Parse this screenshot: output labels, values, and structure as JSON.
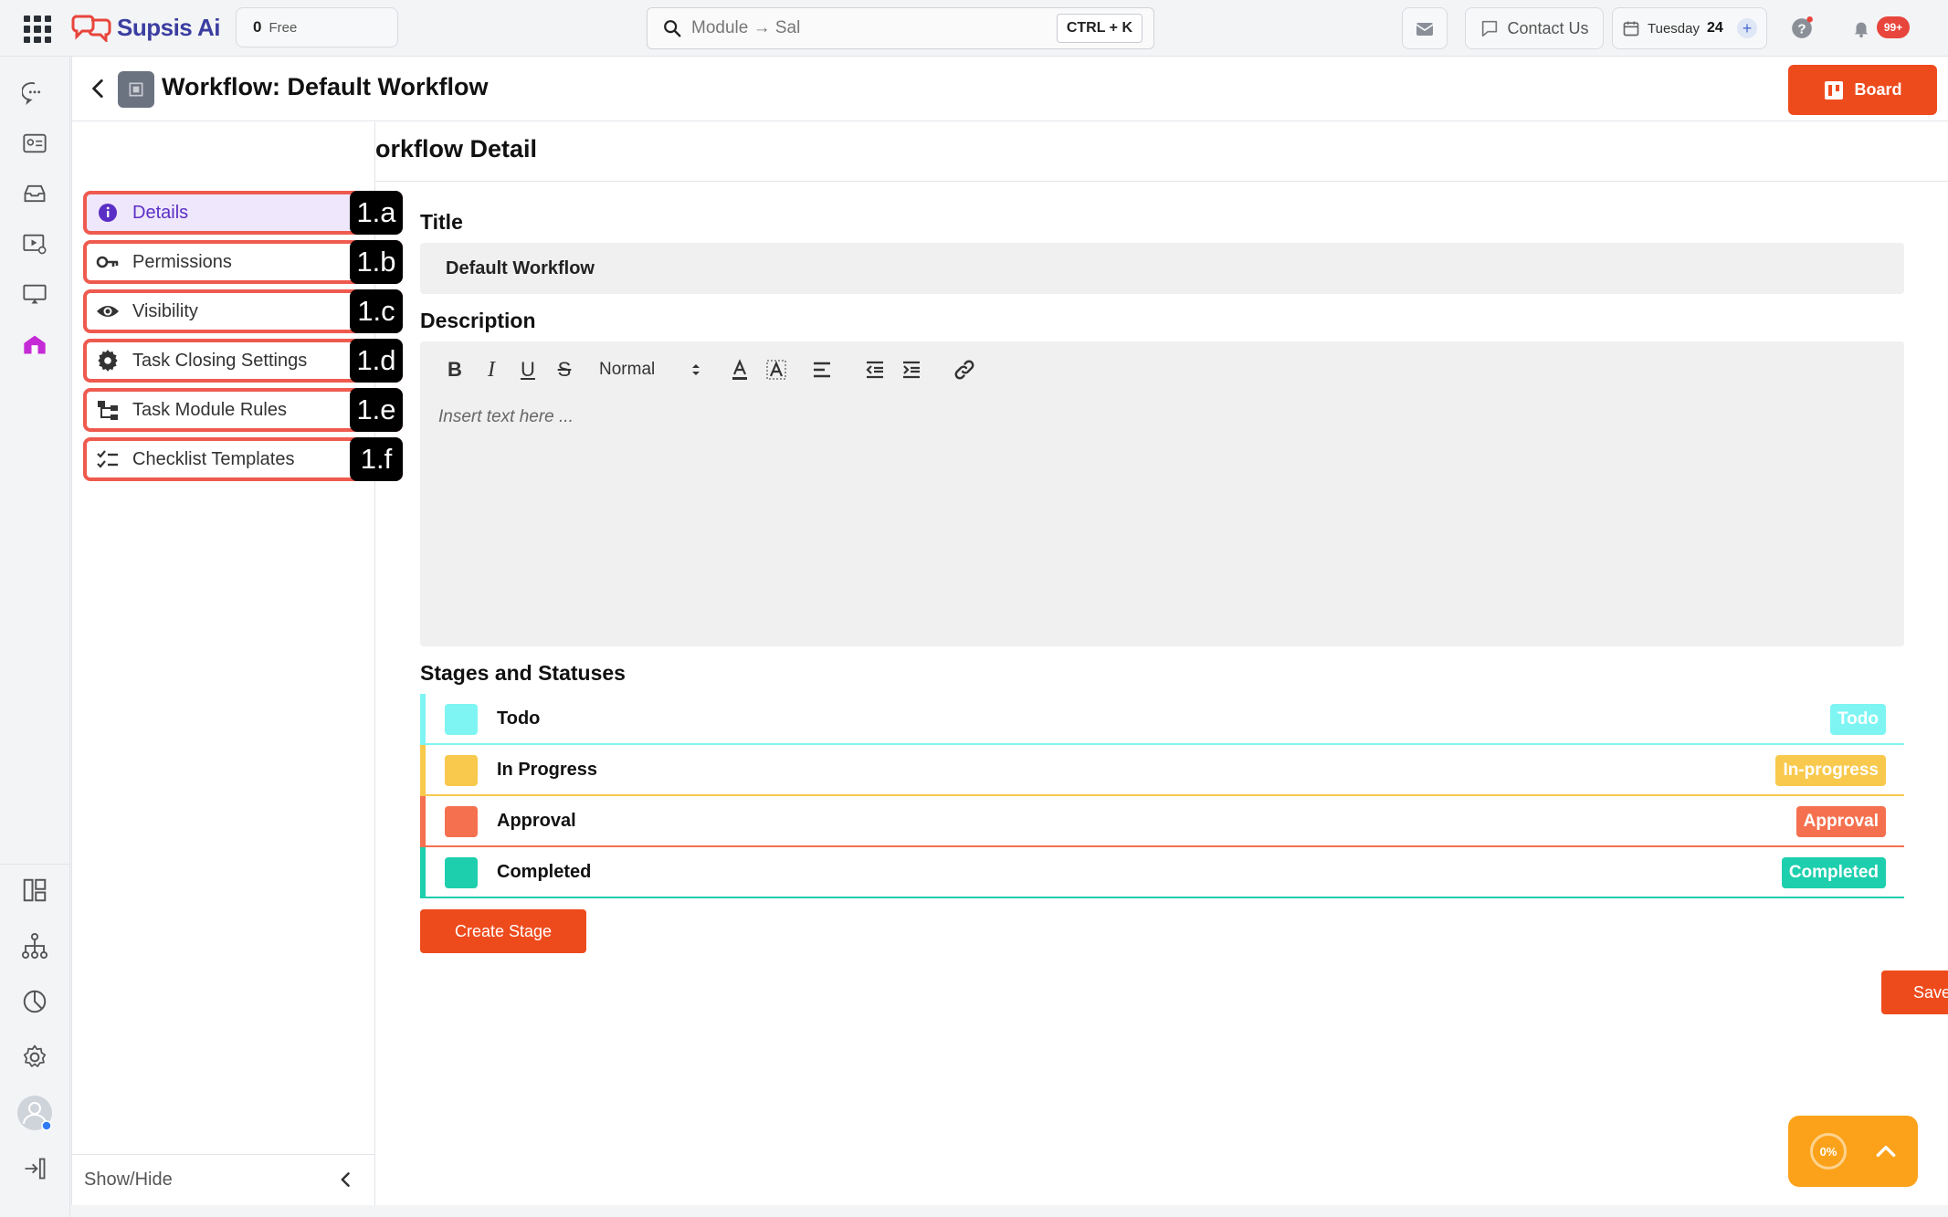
{
  "topbar": {
    "logo_text": "Supsis Ai",
    "credits_count": "0",
    "credits_label": "Free",
    "search_value": "Module → Sal",
    "search_shortcut": "CTRL + K",
    "contact_label": "Contact Us",
    "date_day": "Tuesday",
    "date_num": "24",
    "notif_count": "99+"
  },
  "header": {
    "title": "Workflow: Default Workflow",
    "board_label": "Board"
  },
  "subnav": {
    "items": [
      {
        "label": "Details",
        "tag": "1.a"
      },
      {
        "label": "Permissions",
        "tag": "1.b"
      },
      {
        "label": "Visibility",
        "tag": "1.c"
      },
      {
        "label": "Task Closing Settings",
        "tag": "1.d"
      },
      {
        "label": "Task Module Rules",
        "tag": "1.e"
      },
      {
        "label": "Checklist Templates",
        "tag": "1.f"
      }
    ],
    "showhide_label": "Show/Hide"
  },
  "content": {
    "section_title": "Workflow Detail",
    "title_label": "Title",
    "title_value": "Default Workflow",
    "description_label": "Description",
    "format_select": "Normal",
    "description_placeholder": "Insert text here ...",
    "stages_label": "Stages and Statuses",
    "stages": [
      {
        "name": "Todo",
        "status": "Todo",
        "color": "#7ef5f3"
      },
      {
        "name": "In Progress",
        "status": "In-progress",
        "color": "#f8c94c"
      },
      {
        "name": "Approval",
        "status": "Approval",
        "color": "#f5704f"
      },
      {
        "name": "Completed",
        "status": "Completed",
        "color": "#1ecfae"
      }
    ],
    "create_stage_label": "Create Stage",
    "save_label": "Save"
  },
  "widget": {
    "progress": "0%"
  },
  "colors": {
    "accent": "#ee4b1d",
    "active_nav": "#5b2fc5",
    "annotation_border": "#ef5a4f"
  }
}
